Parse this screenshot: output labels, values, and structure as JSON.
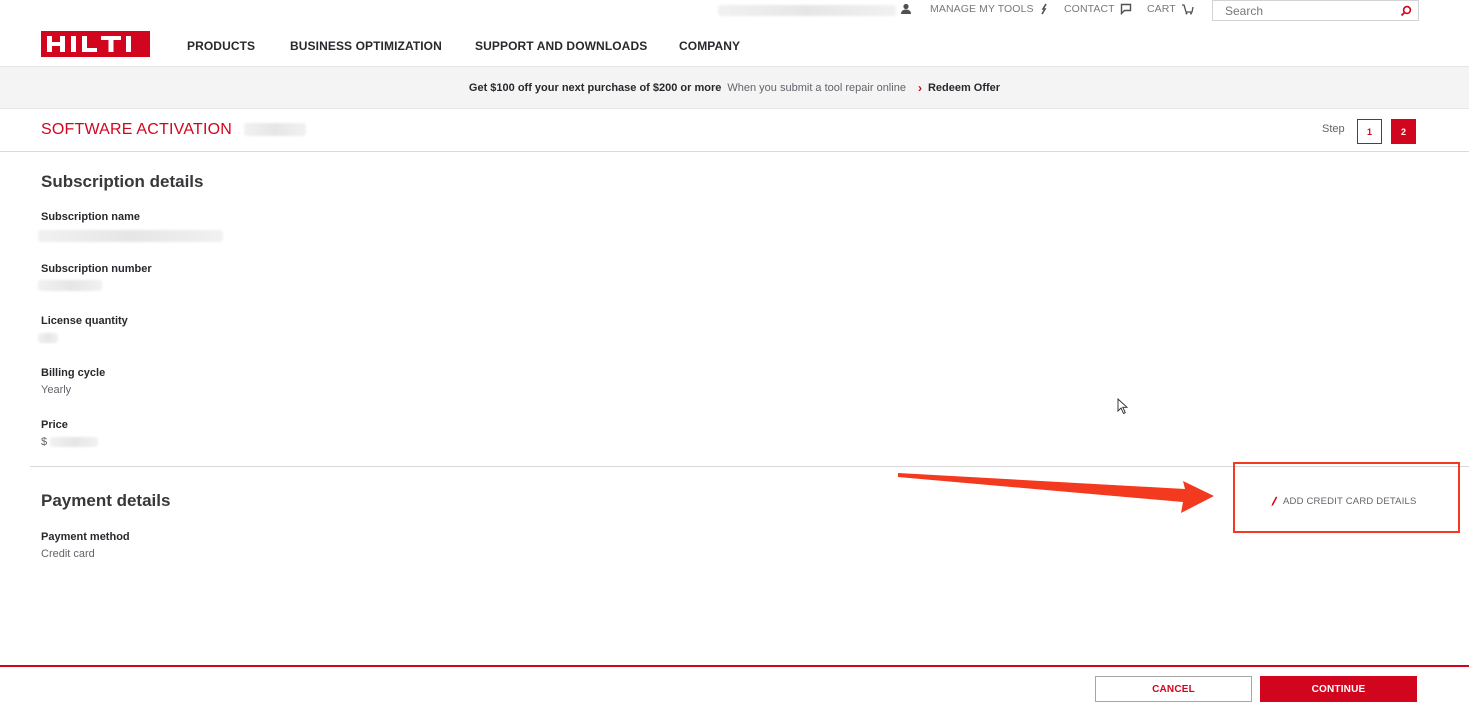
{
  "header": {
    "utility_links": [
      {
        "label": "MANAGE MY TOOLS",
        "icon": "wrench-icon"
      },
      {
        "label": "CONTACT",
        "icon": "chat-icon"
      },
      {
        "label": "CART",
        "icon": "cart-icon"
      }
    ],
    "search_placeholder": "Search",
    "logo_text": "HILTI",
    "nav": [
      "PRODUCTS",
      "BUSINESS OPTIMIZATION",
      "SUPPORT AND DOWNLOADS",
      "COMPANY"
    ]
  },
  "promo": {
    "headline": "Get $100 off your next purchase of $200 or more",
    "subtext": "When you submit a tool repair online",
    "link": "Redeem Offer"
  },
  "page": {
    "title": "SOFTWARE ACTIVATION",
    "step_label": "Step",
    "steps": [
      "1",
      "2"
    ],
    "active_step": "2"
  },
  "subscription": {
    "section_title": "Subscription details",
    "fields": [
      {
        "label": "Subscription name",
        "value": ""
      },
      {
        "label": "Subscription number",
        "value": ""
      },
      {
        "label": "License quantity",
        "value": ""
      },
      {
        "label": "Billing cycle",
        "value": "Yearly"
      },
      {
        "label": "Price",
        "value": "$"
      }
    ]
  },
  "payment": {
    "section_title": "Payment details",
    "method_label": "Payment method",
    "method_value": "Credit card",
    "add_card_label": "ADD CREDIT CARD DETAILS"
  },
  "footer": {
    "cancel_label": "CANCEL",
    "continue_label": "CONTINUE"
  },
  "colors": {
    "brand_red": "#d2051e",
    "annotation_red": "#f33a1e"
  }
}
